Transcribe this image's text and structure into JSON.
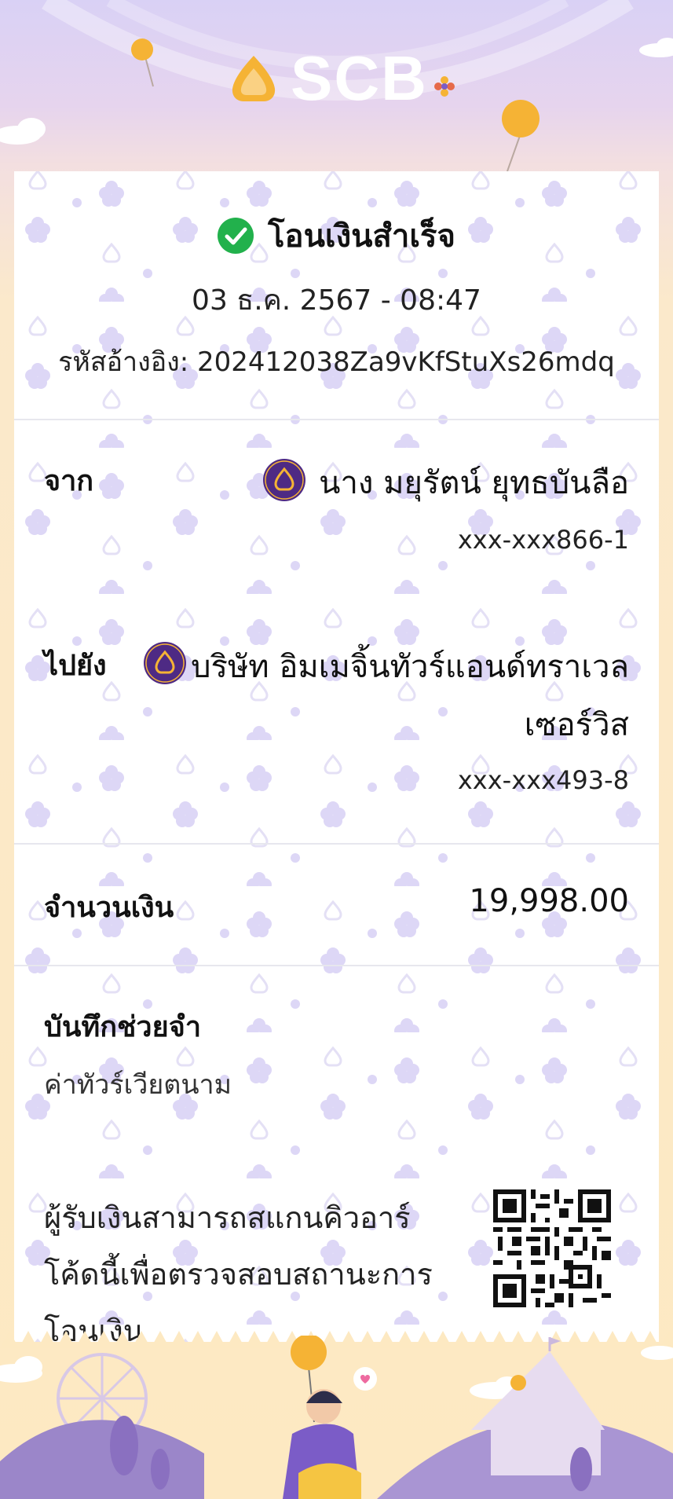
{
  "brand": {
    "name": "SCB",
    "logo_color": "#f5b335"
  },
  "status": {
    "title": "โอนเงินสำเร็จ",
    "icon": "check-circle-icon",
    "color": "#22b14c"
  },
  "datetime": "03 ธ.ค. 2567 - 08:47",
  "reference": "รหัสอ้างอิง: 202412038Za9vKfStuXs26mdq",
  "from": {
    "label": "จาก",
    "name": "นาง มยุรัตน์ ยุทธบันลือ",
    "account": "xxx-xxx866-1"
  },
  "to": {
    "label": "ไปยัง",
    "name_line1": "บริษัท อิมเมจิ้นทัวร์แอนด์ทราเวล",
    "name_line2": "เซอร์วิส",
    "account": "xxx-xxx493-8"
  },
  "amount": {
    "label": "จำนวนเงิน",
    "value": "19,998.00"
  },
  "note": {
    "label": "บันทึกช่วยจำ",
    "value": "ค่าทัวร์เวียตนาม"
  },
  "qr_message": {
    "line1": "ผู้รับเงินสามารถสแกนคิวอาร์",
    "line2": "โค้ดนี้เพื่อตรวจสอบสถานะการ",
    "line3": "โอนเงิน"
  },
  "colors": {
    "accent_purple": "#4e2a84",
    "gold": "#f5b335",
    "pattern_purple": "#d7d0f3"
  }
}
